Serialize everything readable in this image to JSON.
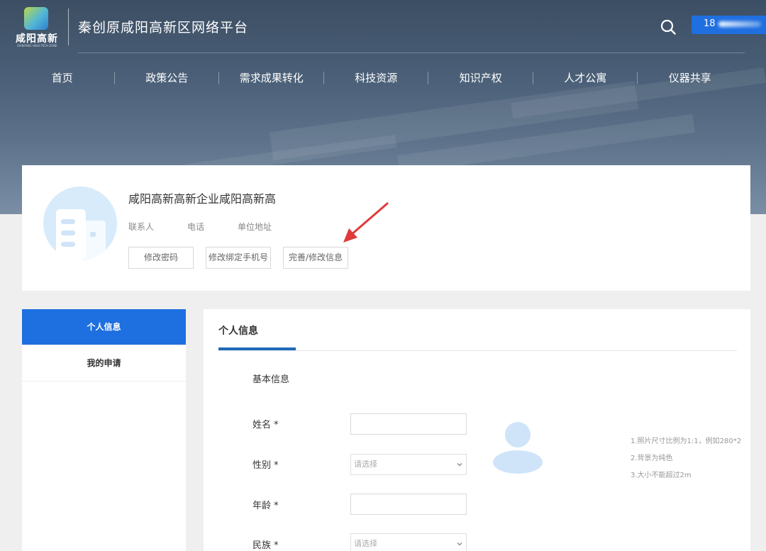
{
  "header": {
    "logo_text": "咸阳高新",
    "logo_subtext": "XIANYANG HIGH-TECH ZONE",
    "site_title": "秦创原咸阳高新区网络平台",
    "user_button_visible_text": "18"
  },
  "nav": {
    "items": [
      {
        "label": "首页"
      },
      {
        "label": "政策公告"
      },
      {
        "label": "需求成果转化"
      },
      {
        "label": "科技资源"
      },
      {
        "label": "知识产权"
      },
      {
        "label": "人才公寓"
      },
      {
        "label": "仪器共享"
      }
    ]
  },
  "profile": {
    "company_name": "咸阳高新高新企业咸阳高新高",
    "labels": {
      "contact": "联系人",
      "phone": "电话",
      "address": "单位地址"
    },
    "buttons": {
      "change_password": "修改密码",
      "change_phone": "修改绑定手机号",
      "edit_info": "完善/修改信息"
    }
  },
  "sidebar": {
    "items": [
      {
        "label": "个人信息",
        "active": true
      },
      {
        "label": "我的申请",
        "active": false
      }
    ]
  },
  "main": {
    "tab_title": "个人信息",
    "section_title": "基本信息",
    "fields": {
      "name": {
        "label": "姓名",
        "required_mark": "*"
      },
      "gender": {
        "label": "性别",
        "required_mark": "*",
        "placeholder": "请选择"
      },
      "age": {
        "label": "年龄",
        "required_mark": "*"
      },
      "ethnicity": {
        "label": "民族",
        "required_mark": "*",
        "placeholder": "请选择"
      }
    },
    "photo_hints": [
      "1.照片尺寸比例为1:1，例如280*2",
      "2.背景为纯色",
      "3.大小不能超过2m"
    ]
  },
  "colors": {
    "primary_blue": "#1e6fdf",
    "tab_underline": "#1f6ab9",
    "avatar_bg": "#d7ebfb",
    "annotation_arrow": "#e03a3a"
  },
  "icons": {
    "search": "search-icon",
    "chevron": "chevron-down-icon",
    "arrow": "annotation-arrow-icon"
  }
}
